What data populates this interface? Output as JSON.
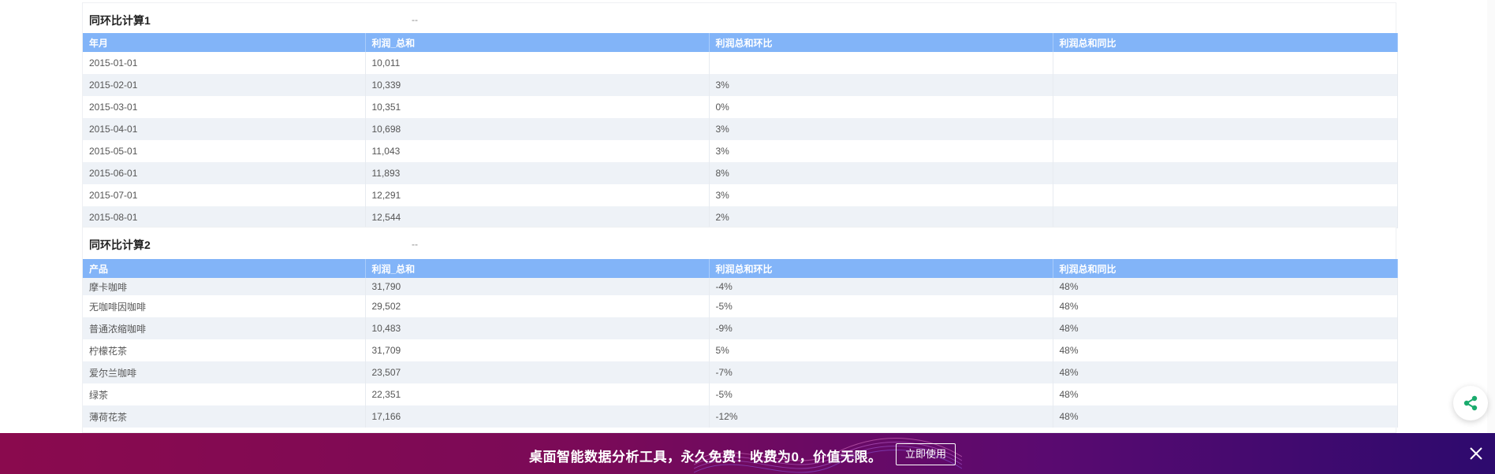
{
  "panel1": {
    "title": "同环比计算1",
    "dash": "--",
    "columns": [
      "年月",
      "利润_总和",
      "利润总和环比",
      "利润总和同比"
    ],
    "rows": [
      [
        "2015-01-01",
        "10,011",
        "",
        ""
      ],
      [
        "2015-02-01",
        "10,339",
        "3%",
        ""
      ],
      [
        "2015-03-01",
        "10,351",
        "0%",
        ""
      ],
      [
        "2015-04-01",
        "10,698",
        "3%",
        ""
      ],
      [
        "2015-05-01",
        "11,043",
        "3%",
        ""
      ],
      [
        "2015-06-01",
        "11,893",
        "8%",
        ""
      ],
      [
        "2015-07-01",
        "12,291",
        "3%",
        ""
      ],
      [
        "2015-08-01",
        "12,544",
        "2%",
        ""
      ]
    ]
  },
  "panel2": {
    "title": "同环比计算2",
    "dash": "--",
    "columns": [
      "产品",
      "利润_总和",
      "利润总和环比",
      "利润总和同比"
    ],
    "rows": [
      [
        "摩卡咖啡",
        "31,790",
        "-4%",
        "48%"
      ],
      [
        "无咖啡因咖啡",
        "29,502",
        "-5%",
        "48%"
      ],
      [
        "普通浓缩咖啡",
        "10,483",
        "-9%",
        "48%"
      ],
      [
        "柠檬花茶",
        "31,709",
        "5%",
        "48%"
      ],
      [
        "爱尔兰咖啡",
        "23,507",
        "-7%",
        "48%"
      ],
      [
        "绿茶",
        "22,351",
        "-5%",
        "48%"
      ],
      [
        "薄荷花茶",
        "17,166",
        "-12%",
        "48%"
      ]
    ]
  },
  "banner": {
    "text": "桌面智能数据分析工具，永久免费！收费为0，价值无限。",
    "button": "立即使用"
  },
  "icons": {
    "share": "share-icon",
    "close": "close-icon"
  },
  "colors": {
    "header_bg": "#82b4f8",
    "stripe_bg": "#eef2f7",
    "share_green": "#1aab6d"
  }
}
